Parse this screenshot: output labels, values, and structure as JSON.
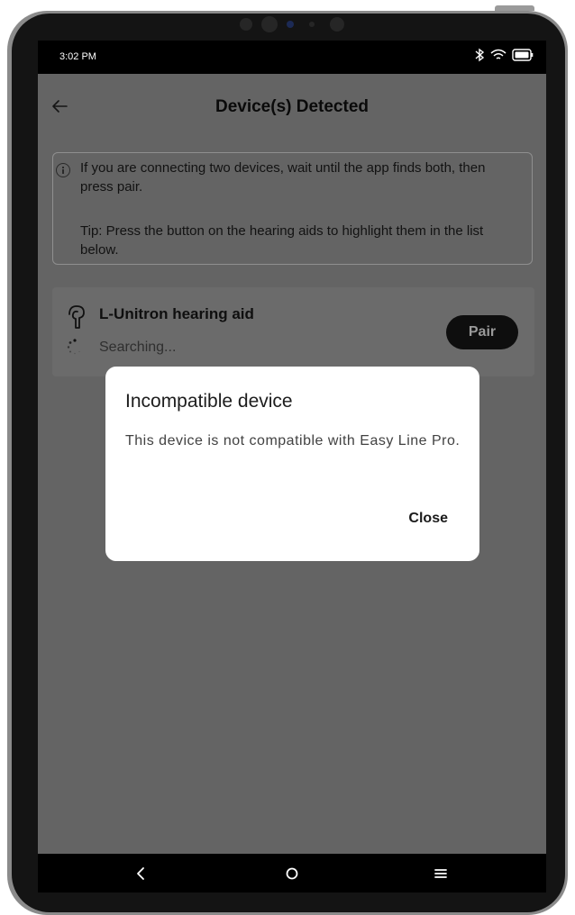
{
  "status_bar": {
    "time": "3:02 PM",
    "icons": [
      "bluetooth-icon",
      "wifi-icon",
      "battery-icon"
    ]
  },
  "app_bar": {
    "back_icon": "back-arrow-icon",
    "title": "Device(s) Detected"
  },
  "info": {
    "icon": "info-icon",
    "line1": "If you are connecting two devices, wait until the app finds both, then press pair.",
    "line2": "Tip: Press the button on the hearing aids to highlight them in the list below."
  },
  "device": {
    "icon": "hearing-aid-icon",
    "name": "L-Unitron hearing aid",
    "status": "Searching...",
    "pair_label": "Pair"
  },
  "dialog": {
    "title": "Incompatible device",
    "message": "This device is not compatible with Easy Line Pro.",
    "close_label": "Close"
  },
  "nav_bar": {
    "icons": [
      "nav-back-icon",
      "nav-home-icon",
      "nav-menu-icon"
    ]
  },
  "colors": {
    "scrim": "#646464",
    "dialog_bg": "#ffffff",
    "pair_button": "#0e0e0e"
  }
}
